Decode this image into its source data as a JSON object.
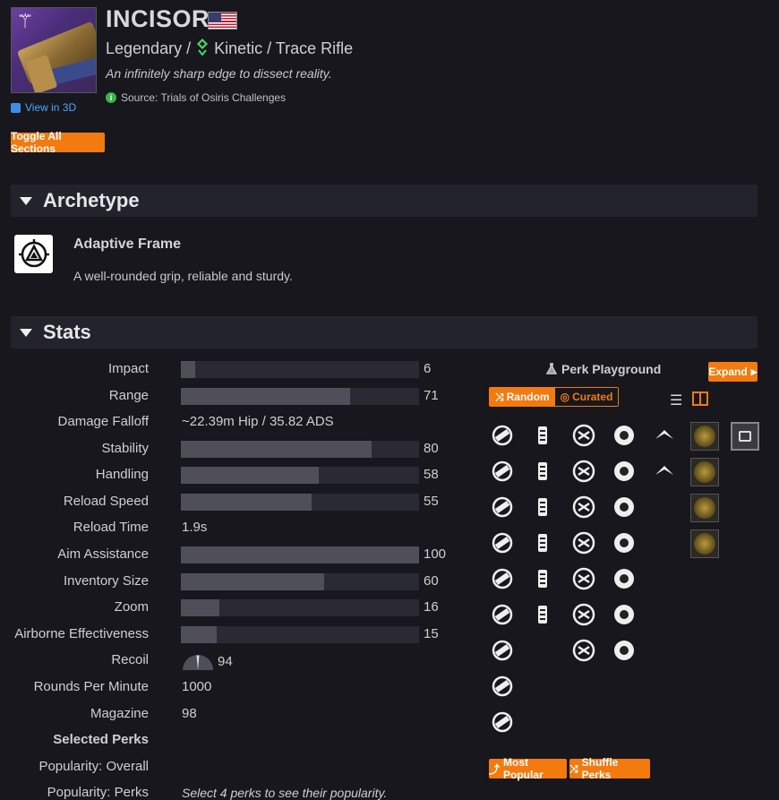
{
  "weapon": {
    "name": "INCISOR",
    "flag_icon": "us-flag-icon",
    "rarity": "Legendary /",
    "ammo_icon": "kinetic-icon",
    "type": "Kinetic / Trace Rifle",
    "flavor": "An infinitely sharp edge to dissect reality.",
    "source": "Source: Trials of Osiris Challenges",
    "view_3d": "View in 3D"
  },
  "toolbar": {
    "toggle_all": "Toggle All Sections"
  },
  "sections": {
    "archetype": "Archetype",
    "stats": "Stats"
  },
  "archetype": {
    "name": "Adaptive Frame",
    "description": "A well-rounded grip, reliable and sturdy."
  },
  "stats": [
    {
      "label": "Impact",
      "value": "6",
      "bar": 6
    },
    {
      "label": "Range",
      "value": "71",
      "bar": 71
    },
    {
      "label": "Damage Falloff",
      "text": "~22.39m Hip / 35.82 ADS"
    },
    {
      "label": "Stability",
      "value": "80",
      "bar": 80
    },
    {
      "label": "Handling",
      "value": "58",
      "bar": 58
    },
    {
      "label": "Reload Speed",
      "value": "55",
      "bar": 55
    },
    {
      "label": "Reload Time",
      "text": "1.9s"
    },
    {
      "label": "Aim Assistance",
      "value": "100",
      "bar": 100
    },
    {
      "label": "Inventory Size",
      "value": "60",
      "bar": 60
    },
    {
      "label": "Zoom",
      "value": "16",
      "bar": 16
    },
    {
      "label": "Airborne Effectiveness",
      "value": "15",
      "bar": 15
    },
    {
      "label": "Recoil",
      "recoil": "94"
    },
    {
      "label": "Rounds Per Minute",
      "text": "1000"
    },
    {
      "label": "Magazine",
      "text": "98"
    },
    {
      "label": "Selected Perks",
      "bold": true
    },
    {
      "label": "Popularity: Overall"
    },
    {
      "label": "Popularity: Perks",
      "italic_text": "Select 4 perks to see their popularity."
    }
  ],
  "perk_playground": {
    "title": "Perk Playground",
    "expand": "Expand",
    "random": "Random",
    "curated": "Curated",
    "most_popular": "Most Popular",
    "shuffle_perks": "Shuffle Perks"
  },
  "colors": {
    "accent": "#f27a0f",
    "background": "#17171d",
    "kinetic": "#4ad86c"
  }
}
